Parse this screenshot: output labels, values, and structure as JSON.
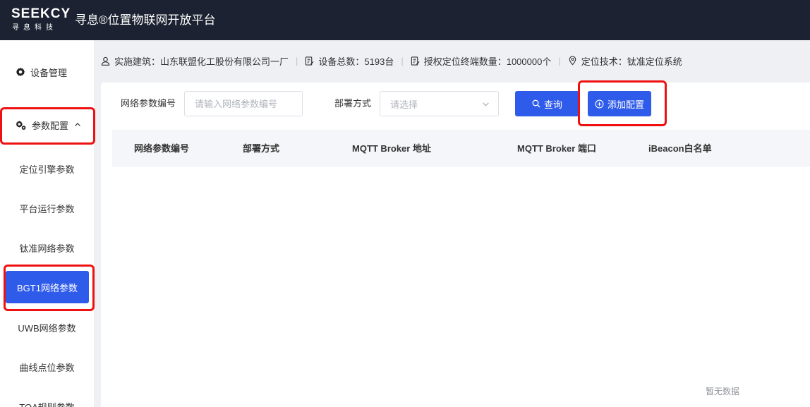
{
  "header": {
    "logo_main": "SEEKCY",
    "logo_sub": "寻息科技",
    "title": "寻息®位置物联网开放平台"
  },
  "sidebar": {
    "device_mgmt": "设备管理",
    "param_config": "参数配置",
    "items": [
      {
        "label": "定位引擎参数"
      },
      {
        "label": "平台运行参数"
      },
      {
        "label": "钛准网络参数"
      },
      {
        "label": "BGT1网络参数"
      },
      {
        "label": "UWB网络参数"
      },
      {
        "label": "曲线点位参数"
      },
      {
        "label": "TOA规则参数"
      }
    ]
  },
  "info": {
    "building": "实施建筑：山东联盟化工股份有限公司一厂",
    "device_total": "设备总数：5193台",
    "license": "授权定位终端数量：1000000个",
    "tech": "定位技术：钛准定位系统",
    "separator": "|"
  },
  "filter": {
    "param_no_label": "网络参数编号",
    "param_no_placeholder": "请输入网络参数编号",
    "deploy_label": "部署方式",
    "deploy_placeholder": "请选择",
    "query_button": "查询",
    "add_button": "添加配置"
  },
  "table": {
    "columns": [
      "网络参数编号",
      "部署方式",
      "MQTT Broker 地址",
      "MQTT Broker 端口",
      "iBeacon白名单"
    ],
    "empty_text": "暂无数据"
  },
  "colors": {
    "primary": "#2f5bea",
    "topbar": "#1c2231",
    "highlight": "#ee1111"
  }
}
